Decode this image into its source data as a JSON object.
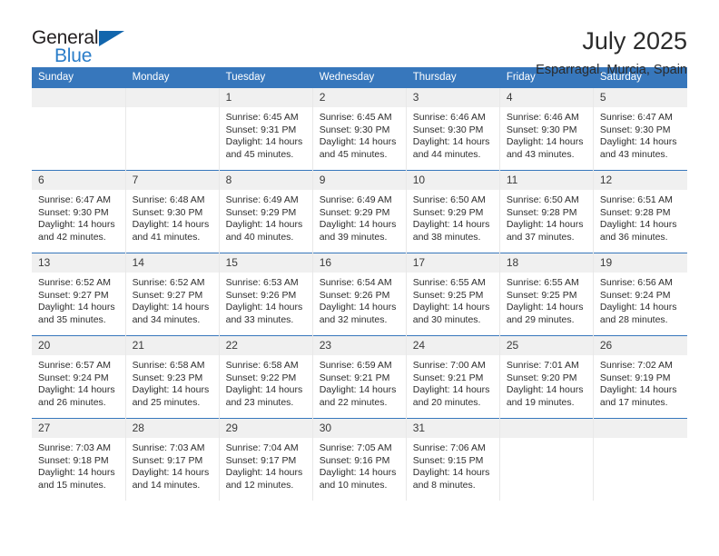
{
  "brand": {
    "name_top": "General",
    "name_bottom": "Blue"
  },
  "header": {
    "month_title": "July 2025",
    "location": "Esparragal, Murcia, Spain"
  },
  "colors": {
    "header_blue": "#3777bc",
    "logo_blue": "#2a7dc9",
    "daynum_bg": "#f0f0f0"
  },
  "weekday_headers": [
    "Sunday",
    "Monday",
    "Tuesday",
    "Wednesday",
    "Thursday",
    "Friday",
    "Saturday"
  ],
  "weeks": [
    [
      {
        "day": "",
        "empty": true
      },
      {
        "day": "",
        "empty": true
      },
      {
        "day": "1",
        "sunrise": "Sunrise: 6:45 AM",
        "sunset": "Sunset: 9:31 PM",
        "daylight": "Daylight: 14 hours and 45 minutes."
      },
      {
        "day": "2",
        "sunrise": "Sunrise: 6:45 AM",
        "sunset": "Sunset: 9:30 PM",
        "daylight": "Daylight: 14 hours and 45 minutes."
      },
      {
        "day": "3",
        "sunrise": "Sunrise: 6:46 AM",
        "sunset": "Sunset: 9:30 PM",
        "daylight": "Daylight: 14 hours and 44 minutes."
      },
      {
        "day": "4",
        "sunrise": "Sunrise: 6:46 AM",
        "sunset": "Sunset: 9:30 PM",
        "daylight": "Daylight: 14 hours and 43 minutes."
      },
      {
        "day": "5",
        "sunrise": "Sunrise: 6:47 AM",
        "sunset": "Sunset: 9:30 PM",
        "daylight": "Daylight: 14 hours and 43 minutes."
      }
    ],
    [
      {
        "day": "6",
        "sunrise": "Sunrise: 6:47 AM",
        "sunset": "Sunset: 9:30 PM",
        "daylight": "Daylight: 14 hours and 42 minutes."
      },
      {
        "day": "7",
        "sunrise": "Sunrise: 6:48 AM",
        "sunset": "Sunset: 9:30 PM",
        "daylight": "Daylight: 14 hours and 41 minutes."
      },
      {
        "day": "8",
        "sunrise": "Sunrise: 6:49 AM",
        "sunset": "Sunset: 9:29 PM",
        "daylight": "Daylight: 14 hours and 40 minutes."
      },
      {
        "day": "9",
        "sunrise": "Sunrise: 6:49 AM",
        "sunset": "Sunset: 9:29 PM",
        "daylight": "Daylight: 14 hours and 39 minutes."
      },
      {
        "day": "10",
        "sunrise": "Sunrise: 6:50 AM",
        "sunset": "Sunset: 9:29 PM",
        "daylight": "Daylight: 14 hours and 38 minutes."
      },
      {
        "day": "11",
        "sunrise": "Sunrise: 6:50 AM",
        "sunset": "Sunset: 9:28 PM",
        "daylight": "Daylight: 14 hours and 37 minutes."
      },
      {
        "day": "12",
        "sunrise": "Sunrise: 6:51 AM",
        "sunset": "Sunset: 9:28 PM",
        "daylight": "Daylight: 14 hours and 36 minutes."
      }
    ],
    [
      {
        "day": "13",
        "sunrise": "Sunrise: 6:52 AM",
        "sunset": "Sunset: 9:27 PM",
        "daylight": "Daylight: 14 hours and 35 minutes."
      },
      {
        "day": "14",
        "sunrise": "Sunrise: 6:52 AM",
        "sunset": "Sunset: 9:27 PM",
        "daylight": "Daylight: 14 hours and 34 minutes."
      },
      {
        "day": "15",
        "sunrise": "Sunrise: 6:53 AM",
        "sunset": "Sunset: 9:26 PM",
        "daylight": "Daylight: 14 hours and 33 minutes."
      },
      {
        "day": "16",
        "sunrise": "Sunrise: 6:54 AM",
        "sunset": "Sunset: 9:26 PM",
        "daylight": "Daylight: 14 hours and 32 minutes."
      },
      {
        "day": "17",
        "sunrise": "Sunrise: 6:55 AM",
        "sunset": "Sunset: 9:25 PM",
        "daylight": "Daylight: 14 hours and 30 minutes."
      },
      {
        "day": "18",
        "sunrise": "Sunrise: 6:55 AM",
        "sunset": "Sunset: 9:25 PM",
        "daylight": "Daylight: 14 hours and 29 minutes."
      },
      {
        "day": "19",
        "sunrise": "Sunrise: 6:56 AM",
        "sunset": "Sunset: 9:24 PM",
        "daylight": "Daylight: 14 hours and 28 minutes."
      }
    ],
    [
      {
        "day": "20",
        "sunrise": "Sunrise: 6:57 AM",
        "sunset": "Sunset: 9:24 PM",
        "daylight": "Daylight: 14 hours and 26 minutes."
      },
      {
        "day": "21",
        "sunrise": "Sunrise: 6:58 AM",
        "sunset": "Sunset: 9:23 PM",
        "daylight": "Daylight: 14 hours and 25 minutes."
      },
      {
        "day": "22",
        "sunrise": "Sunrise: 6:58 AM",
        "sunset": "Sunset: 9:22 PM",
        "daylight": "Daylight: 14 hours and 23 minutes."
      },
      {
        "day": "23",
        "sunrise": "Sunrise: 6:59 AM",
        "sunset": "Sunset: 9:21 PM",
        "daylight": "Daylight: 14 hours and 22 minutes."
      },
      {
        "day": "24",
        "sunrise": "Sunrise: 7:00 AM",
        "sunset": "Sunset: 9:21 PM",
        "daylight": "Daylight: 14 hours and 20 minutes."
      },
      {
        "day": "25",
        "sunrise": "Sunrise: 7:01 AM",
        "sunset": "Sunset: 9:20 PM",
        "daylight": "Daylight: 14 hours and 19 minutes."
      },
      {
        "day": "26",
        "sunrise": "Sunrise: 7:02 AM",
        "sunset": "Sunset: 9:19 PM",
        "daylight": "Daylight: 14 hours and 17 minutes."
      }
    ],
    [
      {
        "day": "27",
        "sunrise": "Sunrise: 7:03 AM",
        "sunset": "Sunset: 9:18 PM",
        "daylight": "Daylight: 14 hours and 15 minutes."
      },
      {
        "day": "28",
        "sunrise": "Sunrise: 7:03 AM",
        "sunset": "Sunset: 9:17 PM",
        "daylight": "Daylight: 14 hours and 14 minutes."
      },
      {
        "day": "29",
        "sunrise": "Sunrise: 7:04 AM",
        "sunset": "Sunset: 9:17 PM",
        "daylight": "Daylight: 14 hours and 12 minutes."
      },
      {
        "day": "30",
        "sunrise": "Sunrise: 7:05 AM",
        "sunset": "Sunset: 9:16 PM",
        "daylight": "Daylight: 14 hours and 10 minutes."
      },
      {
        "day": "31",
        "sunrise": "Sunrise: 7:06 AM",
        "sunset": "Sunset: 9:15 PM",
        "daylight": "Daylight: 14 hours and 8 minutes."
      },
      {
        "day": "",
        "empty": true
      },
      {
        "day": "",
        "empty": true
      }
    ]
  ]
}
